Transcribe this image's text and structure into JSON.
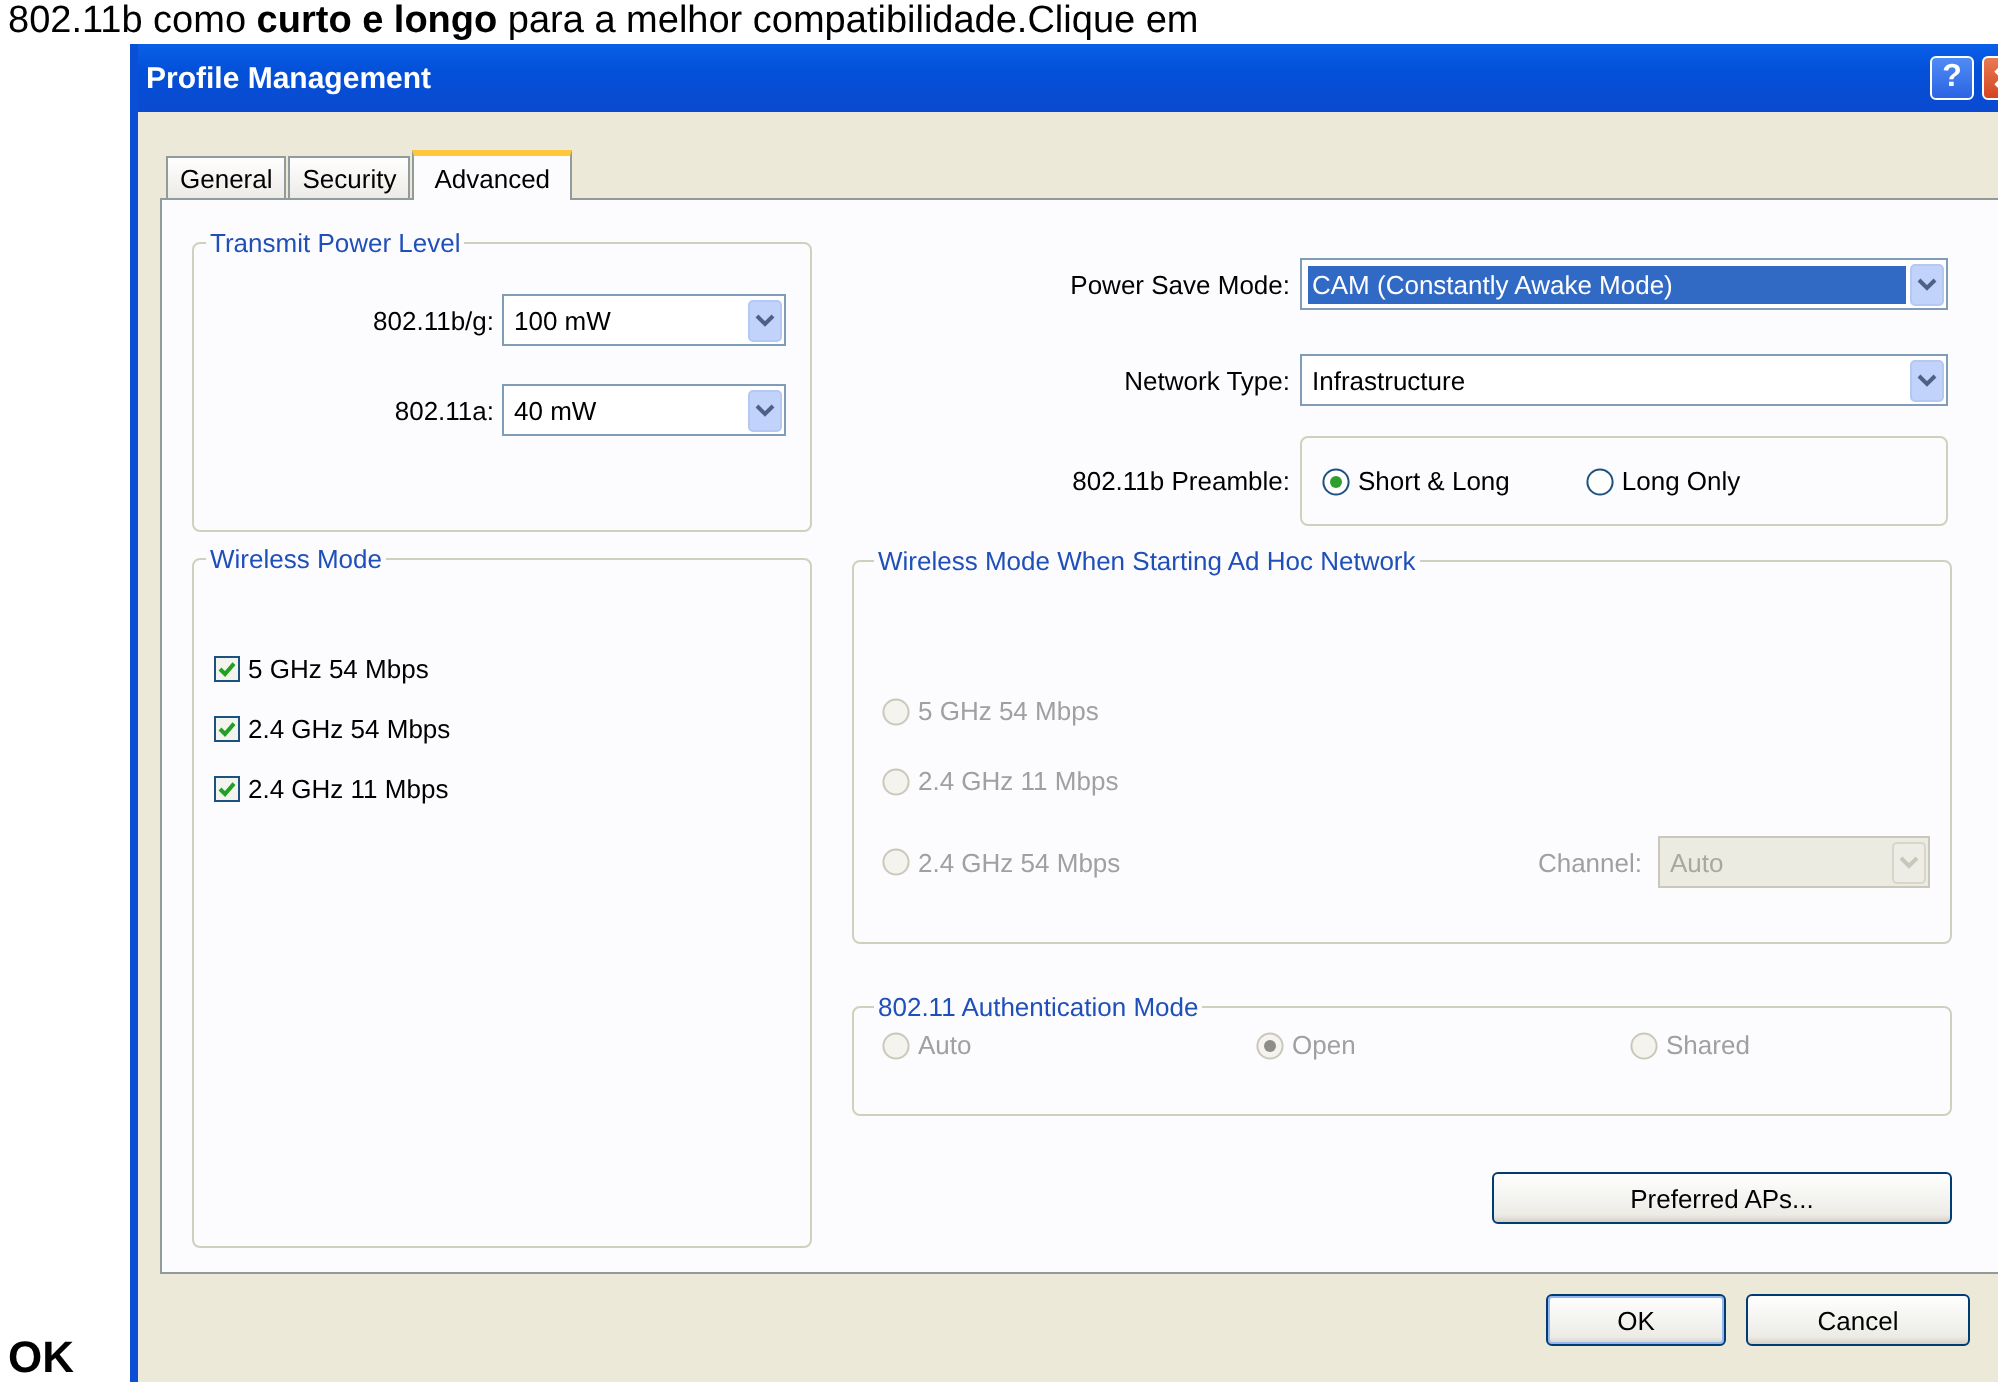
{
  "caption": {
    "text": "802.11b como **curto e longo** para a melhor compatibilidade.Clique em"
  },
  "side_label": "OK",
  "window": {
    "title": "Profile Management",
    "help": "?"
  },
  "tabs": [
    {
      "label": "General",
      "selected": false
    },
    {
      "label": "Security",
      "selected": false
    },
    {
      "label": "Advanced",
      "selected": true
    }
  ],
  "transmit_power": {
    "title": "Transmit Power Level",
    "fields": [
      {
        "label": "802.11b/g:",
        "value": "100 mW"
      },
      {
        "label": "802.11a:",
        "value": "40 mW"
      }
    ]
  },
  "wireless_mode": {
    "title": "Wireless Mode",
    "options": [
      {
        "label": "5 GHz 54 Mbps",
        "checked": true
      },
      {
        "label": "2.4 GHz 54 Mbps",
        "checked": true
      },
      {
        "label": "2.4 GHz 11 Mbps",
        "checked": true
      }
    ]
  },
  "power_save": {
    "label": "Power Save Mode:",
    "value": "CAM (Constantly Awake Mode)",
    "highlighted": true
  },
  "network_type": {
    "label": "Network Type:",
    "value": "Infrastructure"
  },
  "preamble": {
    "label": "802.11b Preamble:",
    "options": [
      {
        "label": "Short & Long",
        "selected": true
      },
      {
        "label": "Long Only",
        "selected": false
      }
    ]
  },
  "ad_hoc": {
    "title": "Wireless Mode When Starting Ad Hoc Network",
    "disabled": true,
    "options": [
      {
        "label": "5 GHz 54 Mbps",
        "selected": false
      },
      {
        "label": "2.4 GHz 11 Mbps",
        "selected": false
      },
      {
        "label": "2.4 GHz 54 Mbps",
        "selected": false
      }
    ],
    "channel": {
      "label": "Channel:",
      "value": "Auto"
    }
  },
  "auth": {
    "title": "802.11 Authentication Mode",
    "disabled": true,
    "options": [
      {
        "label": "Auto",
        "selected": false
      },
      {
        "label": "Open",
        "selected": true
      },
      {
        "label": "Shared",
        "selected": false
      }
    ]
  },
  "buttons": {
    "preferred": "Preferred APs...",
    "ok": "OK",
    "cancel": "Cancel"
  }
}
